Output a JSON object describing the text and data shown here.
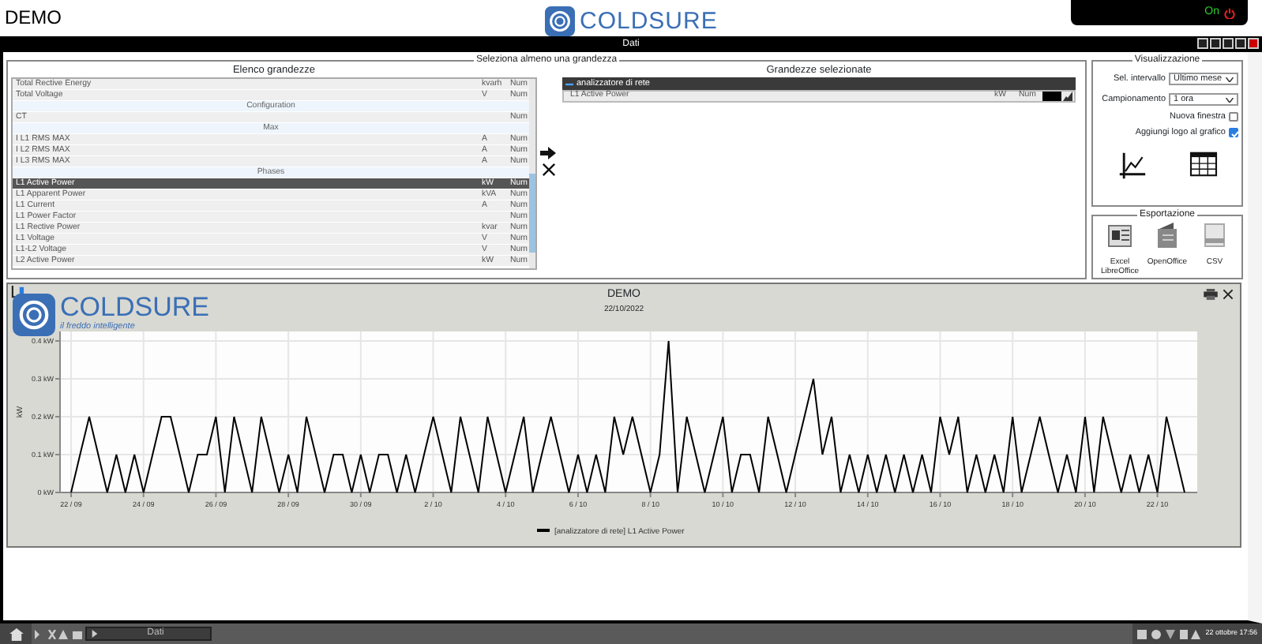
{
  "header": {
    "title": "DEMO",
    "logo_text": "COLDSURE",
    "status": "On"
  },
  "window": {
    "title": "Dati"
  },
  "selection": {
    "legend": "Seleziona almeno una grandezza",
    "list": {
      "title": "Elenco grandezze",
      "rows": [
        {
          "kind": "item",
          "name": "Total Rective Energy",
          "unit": "kvarh",
          "type": "Num",
          "selected": false
        },
        {
          "kind": "item",
          "name": "Total Voltage",
          "unit": "V",
          "type": "Num",
          "selected": false
        },
        {
          "kind": "group",
          "name": "Configuration"
        },
        {
          "kind": "item",
          "name": "CT",
          "type": "Num",
          "selected": false
        },
        {
          "kind": "group",
          "name": "Max"
        },
        {
          "kind": "item",
          "name": "I L1 RMS MAX",
          "unit": "A",
          "type": "Num",
          "selected": false
        },
        {
          "kind": "item",
          "name": "I L2 RMS MAX",
          "unit": "A",
          "type": "Num",
          "selected": false
        },
        {
          "kind": "item",
          "name": "I L3 RMS MAX",
          "unit": "A",
          "type": "Num",
          "selected": false
        },
        {
          "kind": "group",
          "name": "Phases"
        },
        {
          "kind": "item",
          "name": "L1 Active Power",
          "unit": "kW",
          "type": "Num",
          "selected": true
        },
        {
          "kind": "item",
          "name": "L1 Apparent Power",
          "unit": "kVA",
          "type": "Num",
          "selected": false
        },
        {
          "kind": "item",
          "name": "L1 Current",
          "unit": "A",
          "type": "Num",
          "selected": false
        },
        {
          "kind": "item",
          "name": "L1 Power Factor",
          "type": "Num",
          "selected": false
        },
        {
          "kind": "item",
          "name": "L1 Rective Power",
          "unit": "kvar",
          "type": "Num",
          "selected": false
        },
        {
          "kind": "item",
          "name": "L1 Voltage",
          "unit": "V",
          "type": "Num",
          "selected": false
        },
        {
          "kind": "item",
          "name": "L1-L2 Voltage",
          "unit": "V",
          "type": "Num",
          "selected": false
        },
        {
          "kind": "item",
          "name": "L2 Active Power",
          "unit": "kW",
          "type": "Num",
          "selected": false
        }
      ]
    },
    "selected_panel": {
      "title": "Grandezze selezionate",
      "groups": [
        {
          "name": "analizzatore di rete",
          "expanded": true,
          "rows": [
            {
              "name": "L1 Active Power",
              "unit": "kW",
              "type": "Num",
              "color": "#000000"
            }
          ]
        }
      ]
    }
  },
  "visualizzazione": {
    "legend": "Visualizzazione",
    "fields": [
      {
        "kind": "select",
        "label": "Sel. intervallo",
        "value": "Ultimo mese"
      },
      {
        "kind": "select",
        "label": "Campionamento",
        "value": "1 ora"
      },
      {
        "kind": "checkbox",
        "label": "Nuova finestra",
        "checked": false
      },
      {
        "kind": "checkbox",
        "label": "Aggiungi logo al grafico",
        "checked": true
      }
    ]
  },
  "esportazione": {
    "legend": "Esportazione",
    "buttons": [
      {
        "kind": "excel",
        "label": "Excel LibreOffice"
      },
      {
        "kind": "openoffice",
        "label": "OpenOffice"
      },
      {
        "kind": "csv",
        "label": "CSV"
      }
    ]
  },
  "chart": {
    "logo_text": "COLDSURE",
    "tagline": "il freddo intelligente",
    "title": "DEMO",
    "date": "22/10/2022",
    "chart_data": {
      "type": "line",
      "ylabel": "kW",
      "ylim": [
        0,
        0.4
      ],
      "grid": true,
      "categories": [
        "22 / 09",
        null,
        null,
        null,
        null,
        null,
        null,
        null,
        "24 / 09",
        null,
        null,
        null,
        null,
        null,
        null,
        null,
        "26 / 09",
        null,
        null,
        null,
        null,
        null,
        null,
        null,
        "28 / 09",
        null,
        null,
        null,
        null,
        null,
        null,
        null,
        "30 / 09",
        null,
        null,
        null,
        null,
        null,
        null,
        null,
        "2 / 10",
        null,
        null,
        null,
        null,
        null,
        null,
        null,
        "4 / 10",
        null,
        null,
        null,
        null,
        null,
        null,
        null,
        "6 / 10",
        null,
        null,
        null,
        null,
        null,
        null,
        null,
        "8 / 10",
        null,
        null,
        null,
        null,
        null,
        null,
        null,
        "10 / 10",
        null,
        null,
        null,
        null,
        null,
        null,
        null,
        "12 / 10",
        null,
        null,
        null,
        null,
        null,
        null,
        null,
        "14 / 10",
        null,
        null,
        null,
        null,
        null,
        null,
        null,
        "16 / 10",
        null,
        null,
        null,
        null,
        null,
        null,
        null,
        "18 / 10",
        null,
        null,
        null,
        null,
        null,
        null,
        null,
        "20 / 10",
        null,
        null,
        null,
        null,
        null,
        null,
        null,
        "22 / 10",
        null,
        null,
        null
      ],
      "yticks": [
        {
          "value": 0,
          "label": "0 kW"
        },
        {
          "value": 0.1,
          "label": "0.1 kW"
        },
        {
          "value": 0.2,
          "label": "0.2 kW"
        },
        {
          "value": 0.3,
          "label": "0.3 kW"
        },
        {
          "value": 0.4,
          "label": "0.4 kW"
        }
      ],
      "series": [
        {
          "name": "[analizzatore di rete] L1 Active Power",
          "color": "#000000",
          "values": [
            0,
            0.1,
            0.2,
            0.1,
            0,
            0.1,
            0,
            0.1,
            0,
            0.1,
            0.2,
            0.2,
            0.1,
            0,
            0.1,
            0.1,
            0.2,
            0,
            0.2,
            0.1,
            0,
            0.2,
            0.1,
            0,
            0.1,
            0,
            0.2,
            0.1,
            0,
            0.1,
            0.1,
            0,
            0.1,
            0,
            0.1,
            0.1,
            0,
            0.1,
            0,
            0.1,
            0.2,
            0.1,
            0,
            0.2,
            0.1,
            0,
            0.2,
            0.1,
            0,
            0.1,
            0.2,
            0,
            0.1,
            0.2,
            0.1,
            0,
            0.1,
            0,
            0.1,
            0,
            0.2,
            0.1,
            0.2,
            0.1,
            0,
            0.1,
            0.4,
            0,
            0.2,
            0.1,
            0,
            0.1,
            0.2,
            0,
            0.1,
            0.1,
            0,
            0.2,
            0.1,
            0,
            0.1,
            0.2,
            0.3,
            0.1,
            0.2,
            0,
            0.1,
            0,
            0.1,
            0,
            0.1,
            0,
            0.1,
            0,
            0.1,
            0,
            0.2,
            0.1,
            0.2,
            0,
            0.1,
            0,
            0.1,
            0,
            0.2,
            0,
            0.1,
            0.2,
            0.1,
            0,
            0.1,
            0,
            0.2,
            0,
            0.2,
            0.1,
            0,
            0.1,
            0,
            0.1,
            0,
            0.2,
            0.1,
            0
          ]
        }
      ]
    }
  },
  "taskbar": {
    "task": "Dati",
    "clock": "22 ottobre 17:56"
  }
}
